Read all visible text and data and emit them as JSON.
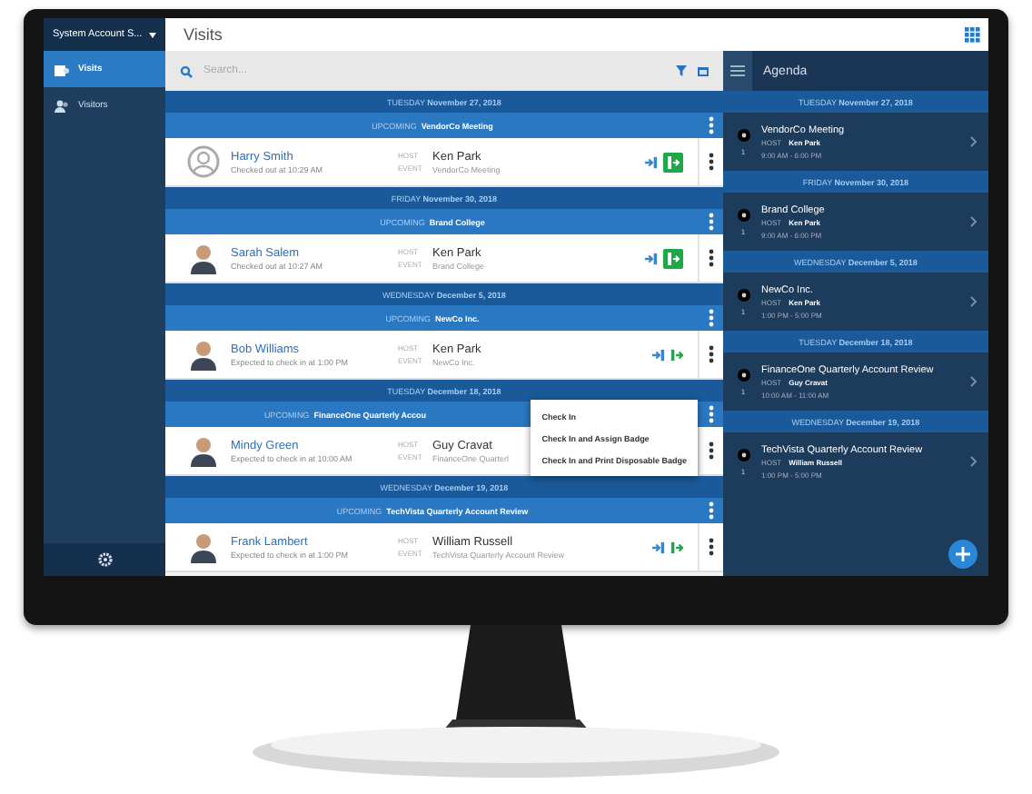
{
  "sidebar": {
    "account": "System Account S...",
    "items": [
      {
        "label": "Visits",
        "kind": "visits",
        "selected": true
      },
      {
        "label": "Visitors",
        "kind": "visitors",
        "selected": false
      }
    ]
  },
  "header": {
    "title": "Visits"
  },
  "search": {
    "placeholder": "Search..."
  },
  "groups": [
    {
      "weekday": "TUESDAY",
      "date": "November 27, 2018",
      "status": "UPCOMING",
      "event": "VendorCo Meeting",
      "visit": {
        "name": "Harry Smith",
        "note": "Checked out at 10:29 AM",
        "avatar": {
          "kind": "placeholder"
        },
        "host_label": "HOST",
        "host": "Ken Park",
        "event_label": "EVENT",
        "event": "VendorCo Meeting",
        "actions": {
          "kind": "checked_out"
        }
      }
    },
    {
      "weekday": "FRIDAY",
      "date": "November 30, 2018",
      "status": "UPCOMING",
      "event": "Brand College",
      "visit": {
        "name": "Sarah Salem",
        "note": "Checked out at 10:27 AM",
        "avatar": {
          "kind": "person"
        },
        "host_label": "HOST",
        "host": "Ken Park",
        "event_label": "EVENT",
        "event": "Brand College",
        "actions": {
          "kind": "checked_out"
        }
      }
    },
    {
      "weekday": "WEDNESDAY",
      "date": "December 5, 2018",
      "status": "UPCOMING",
      "event": "NewCo Inc.",
      "visit": {
        "name": "Bob Williams",
        "note": "Expected to check in at 1:00 PM",
        "avatar": {
          "kind": "person"
        },
        "host_label": "HOST",
        "host": "Ken Park",
        "event_label": "EVENT",
        "event": "NewCo Inc.",
        "actions": {
          "kind": "expected"
        }
      }
    },
    {
      "weekday": "TUESDAY",
      "date": "December 18, 2018",
      "status": "UPCOMING",
      "event": "FinanceOne Quarterly Accou",
      "visit": {
        "name": "Mindy Green",
        "note": "Expected to check in at 10:00 AM",
        "avatar": {
          "kind": "person"
        },
        "host_label": "HOST",
        "host": "Guy Cravat",
        "event_label": "EVENT",
        "event": "FinanceOne Quarterl"
      },
      "menu": [
        "Check In",
        "Check In and Assign Badge",
        "Check In and Print Disposable Badge"
      ]
    },
    {
      "weekday": "WEDNESDAY",
      "date": "December 19, 2018",
      "status": "UPCOMING",
      "event": "TechVista Quarterly Account Review",
      "visit": {
        "name": "Frank Lambert",
        "note": "Expected to check in at 1:00 PM",
        "avatar": {
          "kind": "person"
        },
        "host_label": "HOST",
        "host": "William Russell",
        "event_label": "EVENT",
        "event": "TechVista Quarterly Account Review",
        "actions": {
          "kind": "expected"
        }
      }
    }
  ],
  "agenda": {
    "title": "Agenda",
    "groups": [
      {
        "weekday": "TUESDAY",
        "date": "November 27, 2018",
        "title": "VendorCo Meeting",
        "host_label": "HOST",
        "host": "Ken Park",
        "time": "9:00 AM - 6:00 PM",
        "count": "1"
      },
      {
        "weekday": "FRIDAY",
        "date": "November 30, 2018",
        "title": "Brand College",
        "host_label": "HOST",
        "host": "Ken Park",
        "time": "9:00 AM - 6:00 PM",
        "count": "1"
      },
      {
        "weekday": "WEDNESDAY",
        "date": "December 5, 2018",
        "title": "NewCo Inc.",
        "host_label": "HOST",
        "host": "Ken Park",
        "time": "1:00 PM - 5:00 PM",
        "count": "1"
      },
      {
        "weekday": "TUESDAY",
        "date": "December 18, 2018",
        "title": "FinanceOne Quarterly Account Review",
        "host_label": "HOST",
        "host": "Guy Cravat",
        "time": "10:00 AM - 11:00 AM",
        "count": "1"
      },
      {
        "weekday": "WEDNESDAY",
        "date": "December 19, 2018",
        "title": "TechVista Quarterly Account Review",
        "host_label": "HOST",
        "host": "William Russell",
        "time": "1:00 PM - 5:00 PM",
        "count": "1"
      }
    ]
  }
}
